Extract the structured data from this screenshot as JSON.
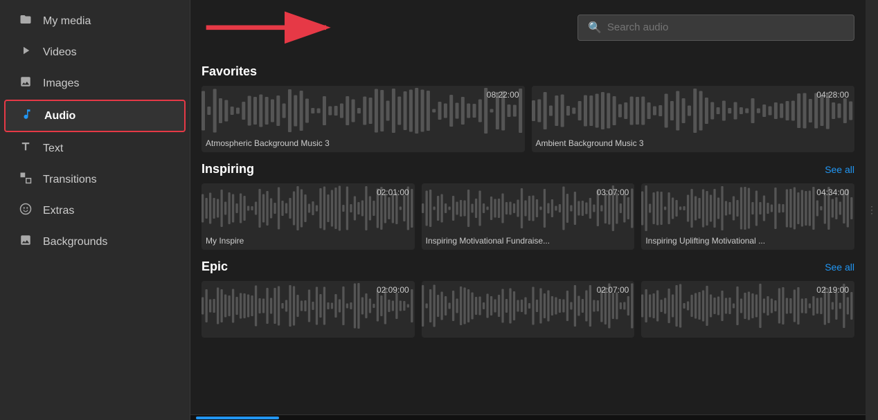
{
  "sidebar": {
    "items": [
      {
        "id": "my-media",
        "label": "My media",
        "icon": "🗂",
        "active": false
      },
      {
        "id": "videos",
        "label": "Videos",
        "icon": "▶",
        "active": false
      },
      {
        "id": "images",
        "label": "Images",
        "icon": "🖼",
        "active": false
      },
      {
        "id": "audio",
        "label": "Audio",
        "icon": "♪",
        "active": true
      },
      {
        "id": "text",
        "label": "Text",
        "icon": "A",
        "active": false
      },
      {
        "id": "transitions",
        "label": "Transitions",
        "icon": "⬛",
        "active": false
      },
      {
        "id": "extras",
        "label": "Extras",
        "icon": "☺",
        "active": false
      },
      {
        "id": "backgrounds",
        "label": "Backgrounds",
        "icon": "🖼",
        "active": false
      }
    ]
  },
  "search": {
    "placeholder": "Search audio"
  },
  "sections": [
    {
      "id": "favorites",
      "title": "Favorites",
      "show_see_all": false,
      "see_all_label": "See all",
      "cards": [
        {
          "label": "Atmospheric Background Music 3",
          "duration": "08:22:00"
        },
        {
          "label": "Ambient Background Music 3",
          "duration": "04:28:00"
        }
      ]
    },
    {
      "id": "inspiring",
      "title": "Inspiring",
      "show_see_all": true,
      "see_all_label": "See all",
      "cards": [
        {
          "label": "My Inspire",
          "duration": "02:01:00"
        },
        {
          "label": "Inspiring Motivational Fundraise...",
          "duration": "03:07:00"
        },
        {
          "label": "Inspiring Uplifting Motivational ...",
          "duration": "04:34:00"
        }
      ]
    },
    {
      "id": "epic",
      "title": "Epic",
      "show_see_all": true,
      "see_all_label": "See all",
      "cards": [
        {
          "label": "",
          "duration": "02:09:00"
        },
        {
          "label": "",
          "duration": "02:07:00"
        },
        {
          "label": "",
          "duration": "02:19:00"
        }
      ]
    }
  ],
  "collapse_handle": "⋮"
}
